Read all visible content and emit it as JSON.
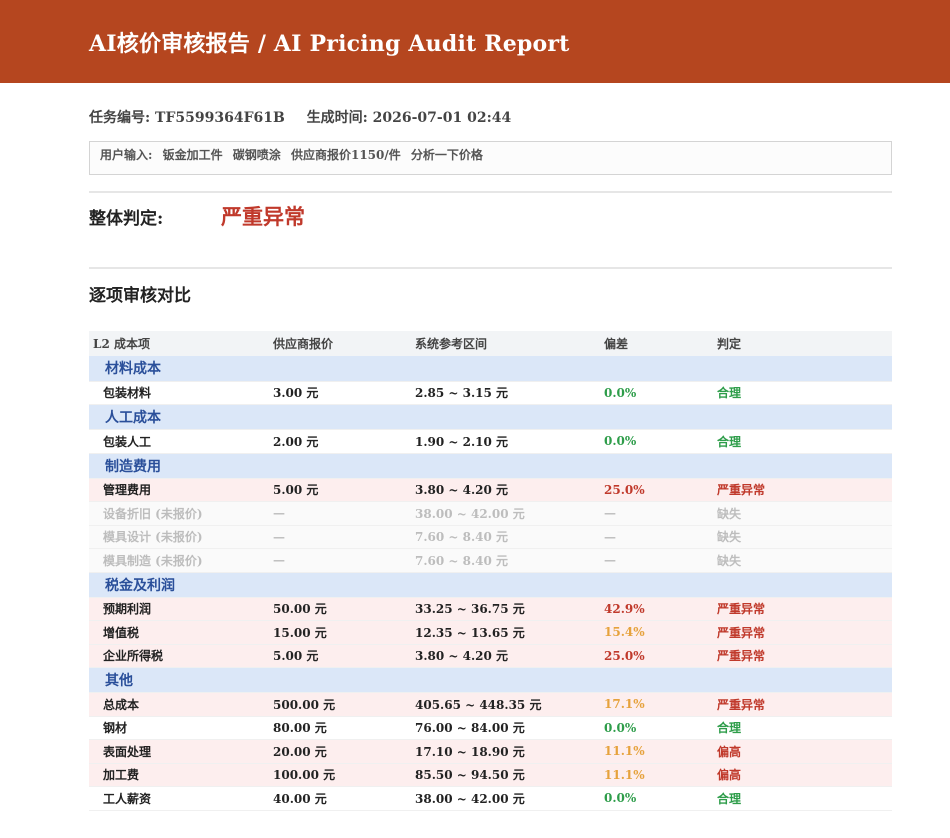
{
  "header": {
    "title": "AI核价审核报告 / AI Pricing Audit Report"
  },
  "meta": {
    "task_label": "任务编号:",
    "task_id": "TF5599364F61B",
    "time_label": "生成时间:",
    "time_value": "2026-07-01 02:44"
  },
  "user_input": {
    "text": "用户输入: 钣金加工件 碳钢喷涂 供应商报价1150/件 分析一下价格"
  },
  "verdict": {
    "label": "整体判定:",
    "value": "严重异常"
  },
  "section": {
    "title": "逐项审核对比"
  },
  "table": {
    "headers": [
      "L2 成本项",
      "供应商报价",
      "系统参考区间",
      "偏差",
      "判定"
    ],
    "rows": [
      {
        "type": "cat",
        "name": "材料成本"
      },
      {
        "type": "item",
        "name": "包装材料",
        "quote": "3.00 元",
        "range": "2.85 ~ 3.15 元",
        "dev": "0.0%",
        "dev_color": "g",
        "judge": "合理",
        "judge_color": "g"
      },
      {
        "type": "cat",
        "name": "人工成本"
      },
      {
        "type": "item",
        "name": "包装人工",
        "quote": "2.00 元",
        "range": "1.90 ~ 2.10 元",
        "dev": "0.0%",
        "dev_color": "g",
        "judge": "合理",
        "judge_color": "g"
      },
      {
        "type": "cat",
        "name": "制造费用"
      },
      {
        "type": "sev",
        "name": "管理费用",
        "quote": "5.00 元",
        "range": "3.80 ~ 4.20 元",
        "dev": "25.0%",
        "dev_color": "r",
        "judge": "严重异常",
        "judge_color": "r"
      },
      {
        "type": "missing",
        "name": "设备折旧 (未报价)",
        "quote": "—",
        "range": "38.00 ~ 42.00 元",
        "dev": "—",
        "dev_color": "",
        "judge": "缺失",
        "judge_color": ""
      },
      {
        "type": "missing",
        "name": "模具设计 (未报价)",
        "quote": "—",
        "range": "7.60 ~ 8.40 元",
        "dev": "—",
        "dev_color": "",
        "judge": "缺失",
        "judge_color": ""
      },
      {
        "type": "missing",
        "name": "模具制造 (未报价)",
        "quote": "—",
        "range": "7.60 ~ 8.40 元",
        "dev": "—",
        "dev_color": "",
        "judge": "缺失",
        "judge_color": ""
      },
      {
        "type": "cat",
        "name": "税金及利润"
      },
      {
        "type": "sev",
        "name": "预期利润",
        "quote": "50.00 元",
        "range": "33.25 ~ 36.75 元",
        "dev": "42.9%",
        "dev_color": "r",
        "judge": "严重异常",
        "judge_color": "r"
      },
      {
        "type": "sev",
        "name": "增值税",
        "quote": "15.00 元",
        "range": "12.35 ~ 13.65 元",
        "dev": "15.4%",
        "dev_color": "o",
        "judge": "严重异常",
        "judge_color": "r"
      },
      {
        "type": "sev",
        "name": "企业所得税",
        "quote": "5.00 元",
        "range": "3.80 ~ 4.20 元",
        "dev": "25.0%",
        "dev_color": "r",
        "judge": "严重异常",
        "judge_color": "r"
      },
      {
        "type": "cat",
        "name": "其他"
      },
      {
        "type": "sev",
        "name": "总成本",
        "quote": "500.00 元",
        "range": "405.65 ~ 448.35 元",
        "dev": "17.1%",
        "dev_color": "o",
        "judge": "严重异常",
        "judge_color": "r"
      },
      {
        "type": "item",
        "name": "钢材",
        "quote": "80.00 元",
        "range": "76.00 ~ 84.00 元",
        "dev": "0.0%",
        "dev_color": "g",
        "judge": "合理",
        "judge_color": "g"
      },
      {
        "type": "sev",
        "name": "表面处理",
        "quote": "20.00 元",
        "range": "17.10 ~ 18.90 元",
        "dev": "11.1%",
        "dev_color": "o",
        "judge": "偏高",
        "judge_color": "r"
      },
      {
        "type": "sev",
        "name": "加工费",
        "quote": "100.00 元",
        "range": "85.50 ~ 94.50 元",
        "dev": "11.1%",
        "dev_color": "o",
        "judge": "偏高",
        "judge_color": "r"
      },
      {
        "type": "item",
        "name": "工人薪资",
        "quote": "40.00 元",
        "range": "38.00 ~ 42.00 元",
        "dev": "0.0%",
        "dev_color": "g",
        "judge": "合理",
        "judge_color": "g"
      }
    ]
  }
}
